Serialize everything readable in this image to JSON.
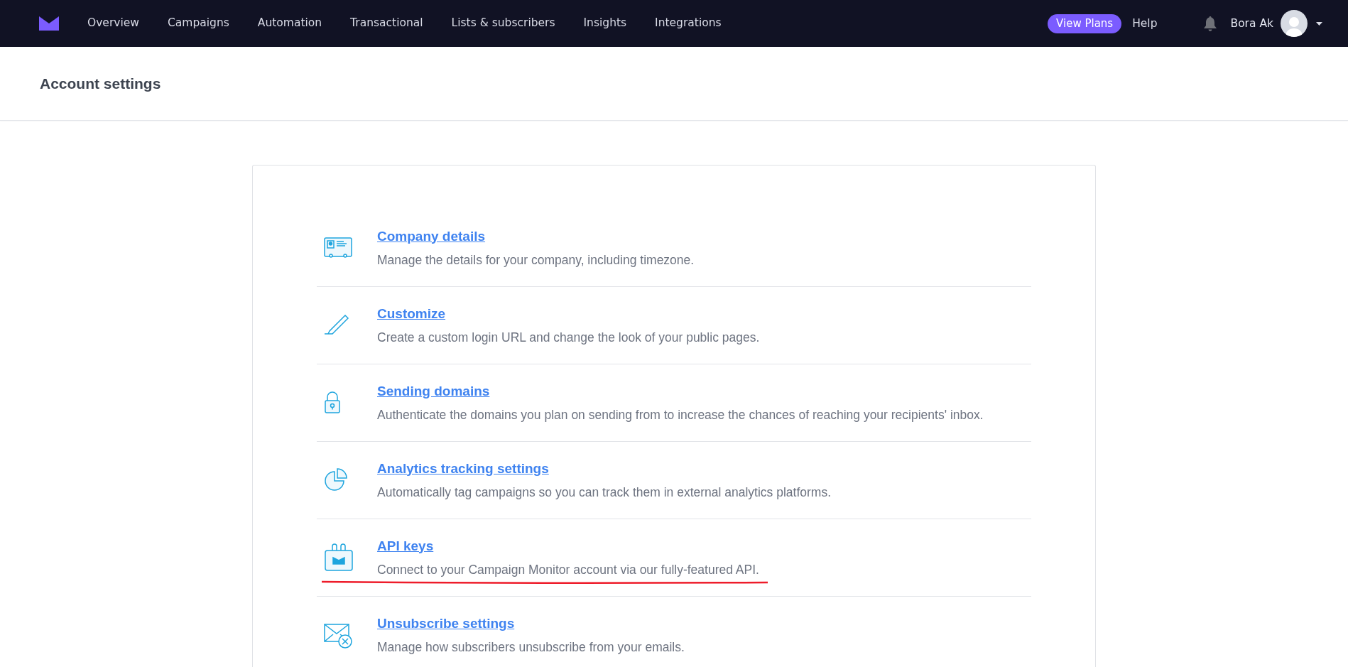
{
  "nav": {
    "items": [
      {
        "label": "Overview",
        "selected": false
      },
      {
        "label": "Campaigns",
        "selected": false
      },
      {
        "label": "Automation",
        "selected": false
      },
      {
        "label": "Transactional",
        "selected": false
      },
      {
        "label": "Lists & subscribers",
        "selected": false
      },
      {
        "label": "Insights",
        "selected": false
      },
      {
        "label": "Integrations",
        "selected": false
      }
    ],
    "plans_button": "View Plans",
    "help": "Help",
    "user_name": "Bora Ak"
  },
  "page_title": "Account settings",
  "settings": [
    {
      "kind": "company",
      "title": "Company details",
      "description": "Manage the details for your company, including timezone.",
      "underlined": false
    },
    {
      "kind": "customize",
      "title": "Customize",
      "description": "Create a custom login URL and change the look of your public pages.",
      "underlined": false
    },
    {
      "kind": "domains",
      "title": "Sending domains",
      "description": "Authenticate the domains you plan on sending from to increase the chances of reaching your recipients' inbox.",
      "underlined": false
    },
    {
      "kind": "analytics",
      "title": "Analytics tracking settings",
      "description": "Automatically tag campaigns so you can track them in external analytics platforms.",
      "underlined": false
    },
    {
      "kind": "api",
      "title": "API keys",
      "description": "Connect to your Campaign Monitor account via our fully-featured API.",
      "underlined": true
    },
    {
      "kind": "unsubscribe",
      "title": "Unsubscribe settings",
      "description": "Manage how subscribers unsubscribe from your emails.",
      "underlined": false
    }
  ]
}
